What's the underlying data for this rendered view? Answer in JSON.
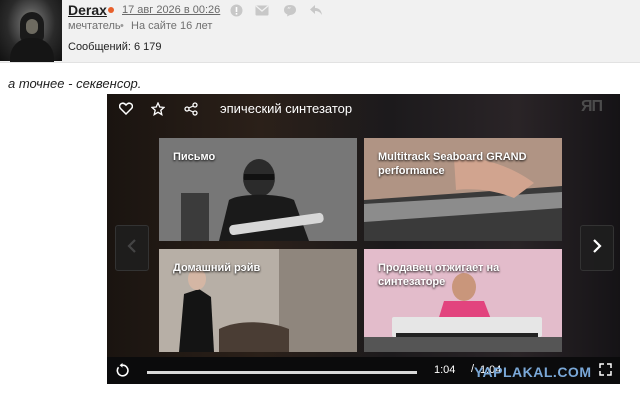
{
  "post": {
    "username": "Derax",
    "date": "17 авг 2026 в 00:26",
    "rank": "мечтатель",
    "separator": "•",
    "on_site": "На сайте 16 лет",
    "messages": "Сообщений: 6 179",
    "text": "а точнее - секвенсор."
  },
  "player": {
    "title": "эпический синтезатор",
    "logo_text": "ЯП",
    "cards": [
      {
        "label_lines": [
          "Письмо"
        ]
      },
      {
        "label_lines": [
          "Multitrack Seaboard GRAND",
          "performance"
        ]
      },
      {
        "label_lines": [
          "Домашний рэйв"
        ]
      },
      {
        "label_lines": [
          "Продавец отжигает на",
          "синтезаторе"
        ]
      }
    ],
    "time_current": "1:04",
    "time_sep": "/",
    "time_total": "1:04"
  },
  "watermark": "YAPLAKAL.COM",
  "colors": {
    "accent_orange": "#e8602c",
    "player_bg": "#0d0d0f",
    "watermark": "#7aa8d8"
  },
  "icons": [
    "like-icon",
    "mail-icon",
    "quote-icon",
    "reply-icon",
    "heart-icon",
    "star-icon",
    "share-icon",
    "replay-icon",
    "fullscreen-icon",
    "chevron-left-icon",
    "chevron-right-icon"
  ]
}
